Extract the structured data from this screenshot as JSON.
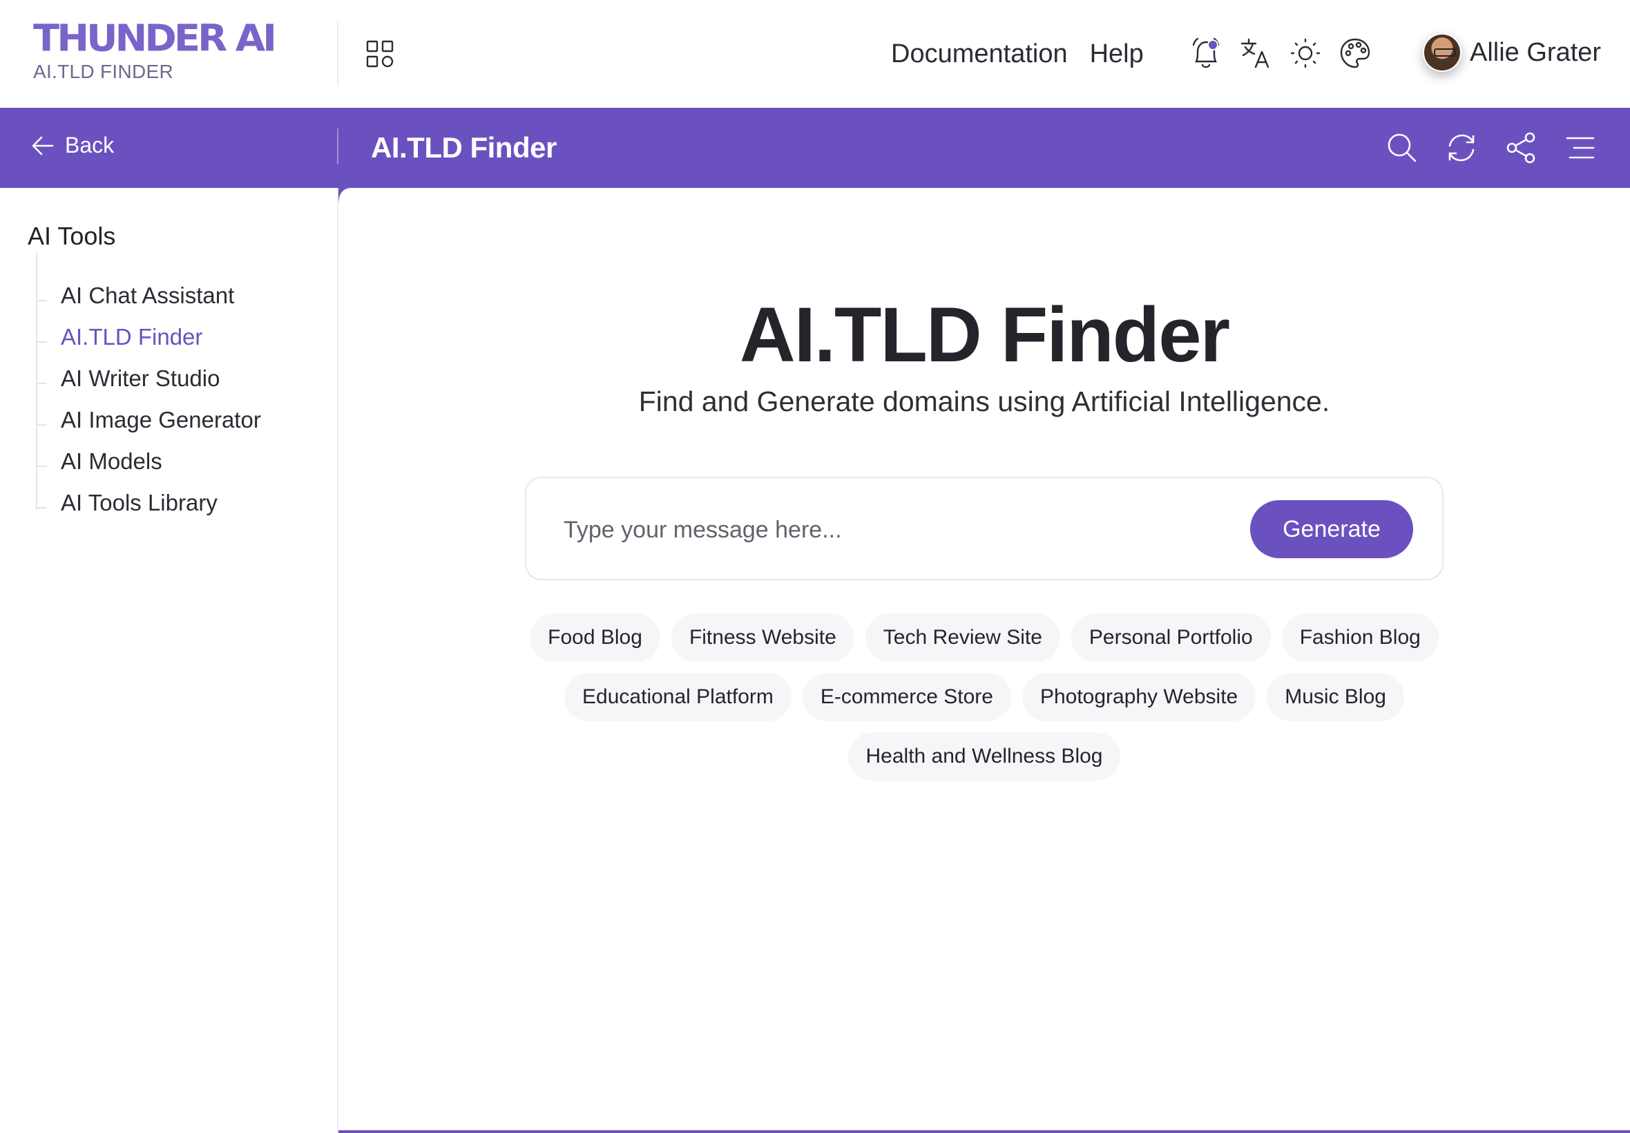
{
  "header": {
    "logo_text": "THUNDER AI",
    "logo_subtitle": "AI.TLD FINDER",
    "apps_icon": "grid-apps-icon",
    "links": [
      {
        "label": "Documentation"
      },
      {
        "label": "Help"
      }
    ],
    "icons": [
      "bell-icon",
      "translate-icon",
      "sun-icon",
      "palette-icon"
    ],
    "notification_dot_color": "#6b51c0",
    "user_name": "Allie Grater"
  },
  "toolbar": {
    "back_label": "Back",
    "title": "AI.TLD Finder",
    "icons": [
      "search-icon",
      "refresh-icon",
      "share-icon",
      "menu-icon"
    ],
    "background_color": "#6b51c0"
  },
  "sidebar": {
    "title": "AI Tools",
    "items": [
      {
        "label": "AI Chat Assistant",
        "active": false
      },
      {
        "label": "AI.TLD Finder",
        "active": true
      },
      {
        "label": "AI Writer Studio",
        "active": false
      },
      {
        "label": "AI Image Generator",
        "active": false
      },
      {
        "label": "AI Models",
        "active": false
      },
      {
        "label": "AI Tools Library",
        "active": false
      }
    ]
  },
  "main": {
    "title": "AI.TLD Finder",
    "subtitle": "Find and Generate domains using Artificial Intelligence.",
    "input_placeholder": "Type your message here...",
    "input_value": "",
    "generate_label": "Generate",
    "suggestions": [
      "Food Blog",
      "Fitness Website",
      "Tech Review Site",
      "Personal Portfolio",
      "Fashion Blog",
      "Educational Platform",
      "E-commerce Store",
      "Photography Website",
      "Music Blog",
      "Health and Wellness Blog"
    ]
  }
}
